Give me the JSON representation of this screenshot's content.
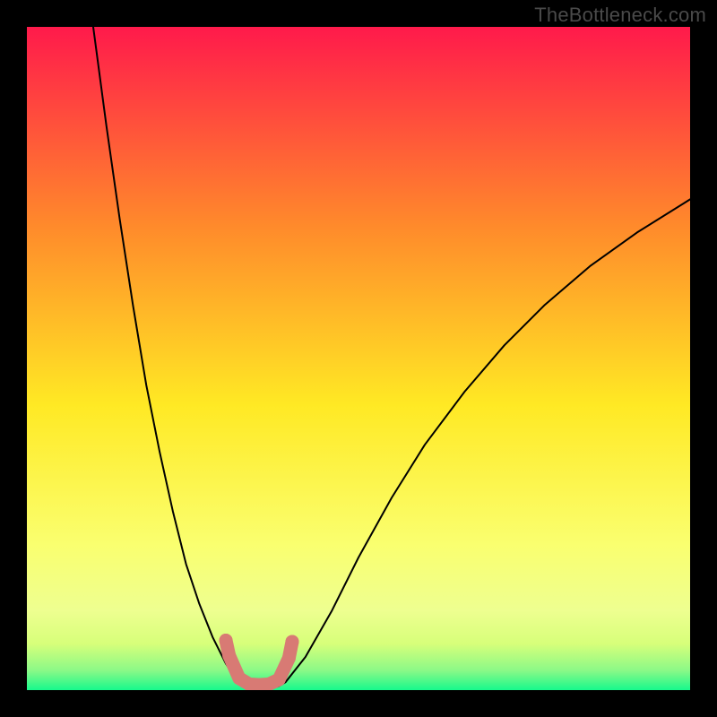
{
  "watermark": "TheBottleneck.com",
  "chart_data": {
    "type": "line",
    "title": "",
    "xlabel": "",
    "ylabel": "",
    "xlim": [
      0,
      100
    ],
    "ylim": [
      0,
      100
    ],
    "gradient_colors": {
      "top": "#ff1a4b",
      "mid_upper": "#ff8a2b",
      "mid": "#ffe924",
      "mid_lower": "#faff6f",
      "low_band": "#d7ff7a",
      "bottom": "#17f98c"
    },
    "series": [
      {
        "name": "curve-left",
        "x": [
          10,
          12,
          14,
          16,
          18,
          20,
          22,
          24,
          26,
          28,
          30,
          32
        ],
        "y": [
          100,
          85,
          71,
          58,
          46,
          36,
          27,
          19,
          13,
          8,
          4,
          1
        ]
      },
      {
        "name": "valley-floor",
        "x": [
          32,
          33,
          34,
          35,
          36,
          37,
          38,
          39
        ],
        "y": [
          1,
          0.4,
          0.2,
          0.2,
          0.2,
          0.3,
          0.6,
          1.2
        ]
      },
      {
        "name": "curve-right",
        "x": [
          39,
          42,
          46,
          50,
          55,
          60,
          66,
          72,
          78,
          85,
          92,
          100
        ],
        "y": [
          1.2,
          5,
          12,
          20,
          29,
          37,
          45,
          52,
          58,
          64,
          69,
          74
        ]
      }
    ],
    "markers": {
      "name": "valley-markers",
      "color": "#d87a74",
      "points": [
        {
          "x": 30.0,
          "y": 7.5
        },
        {
          "x": 30.5,
          "y": 5.2
        },
        {
          "x": 32.0,
          "y": 1.8
        },
        {
          "x": 33.5,
          "y": 0.9
        },
        {
          "x": 35.0,
          "y": 0.8
        },
        {
          "x": 36.5,
          "y": 0.9
        },
        {
          "x": 38.0,
          "y": 1.6
        },
        {
          "x": 39.5,
          "y": 4.8
        },
        {
          "x": 40.0,
          "y": 7.3
        }
      ]
    }
  }
}
